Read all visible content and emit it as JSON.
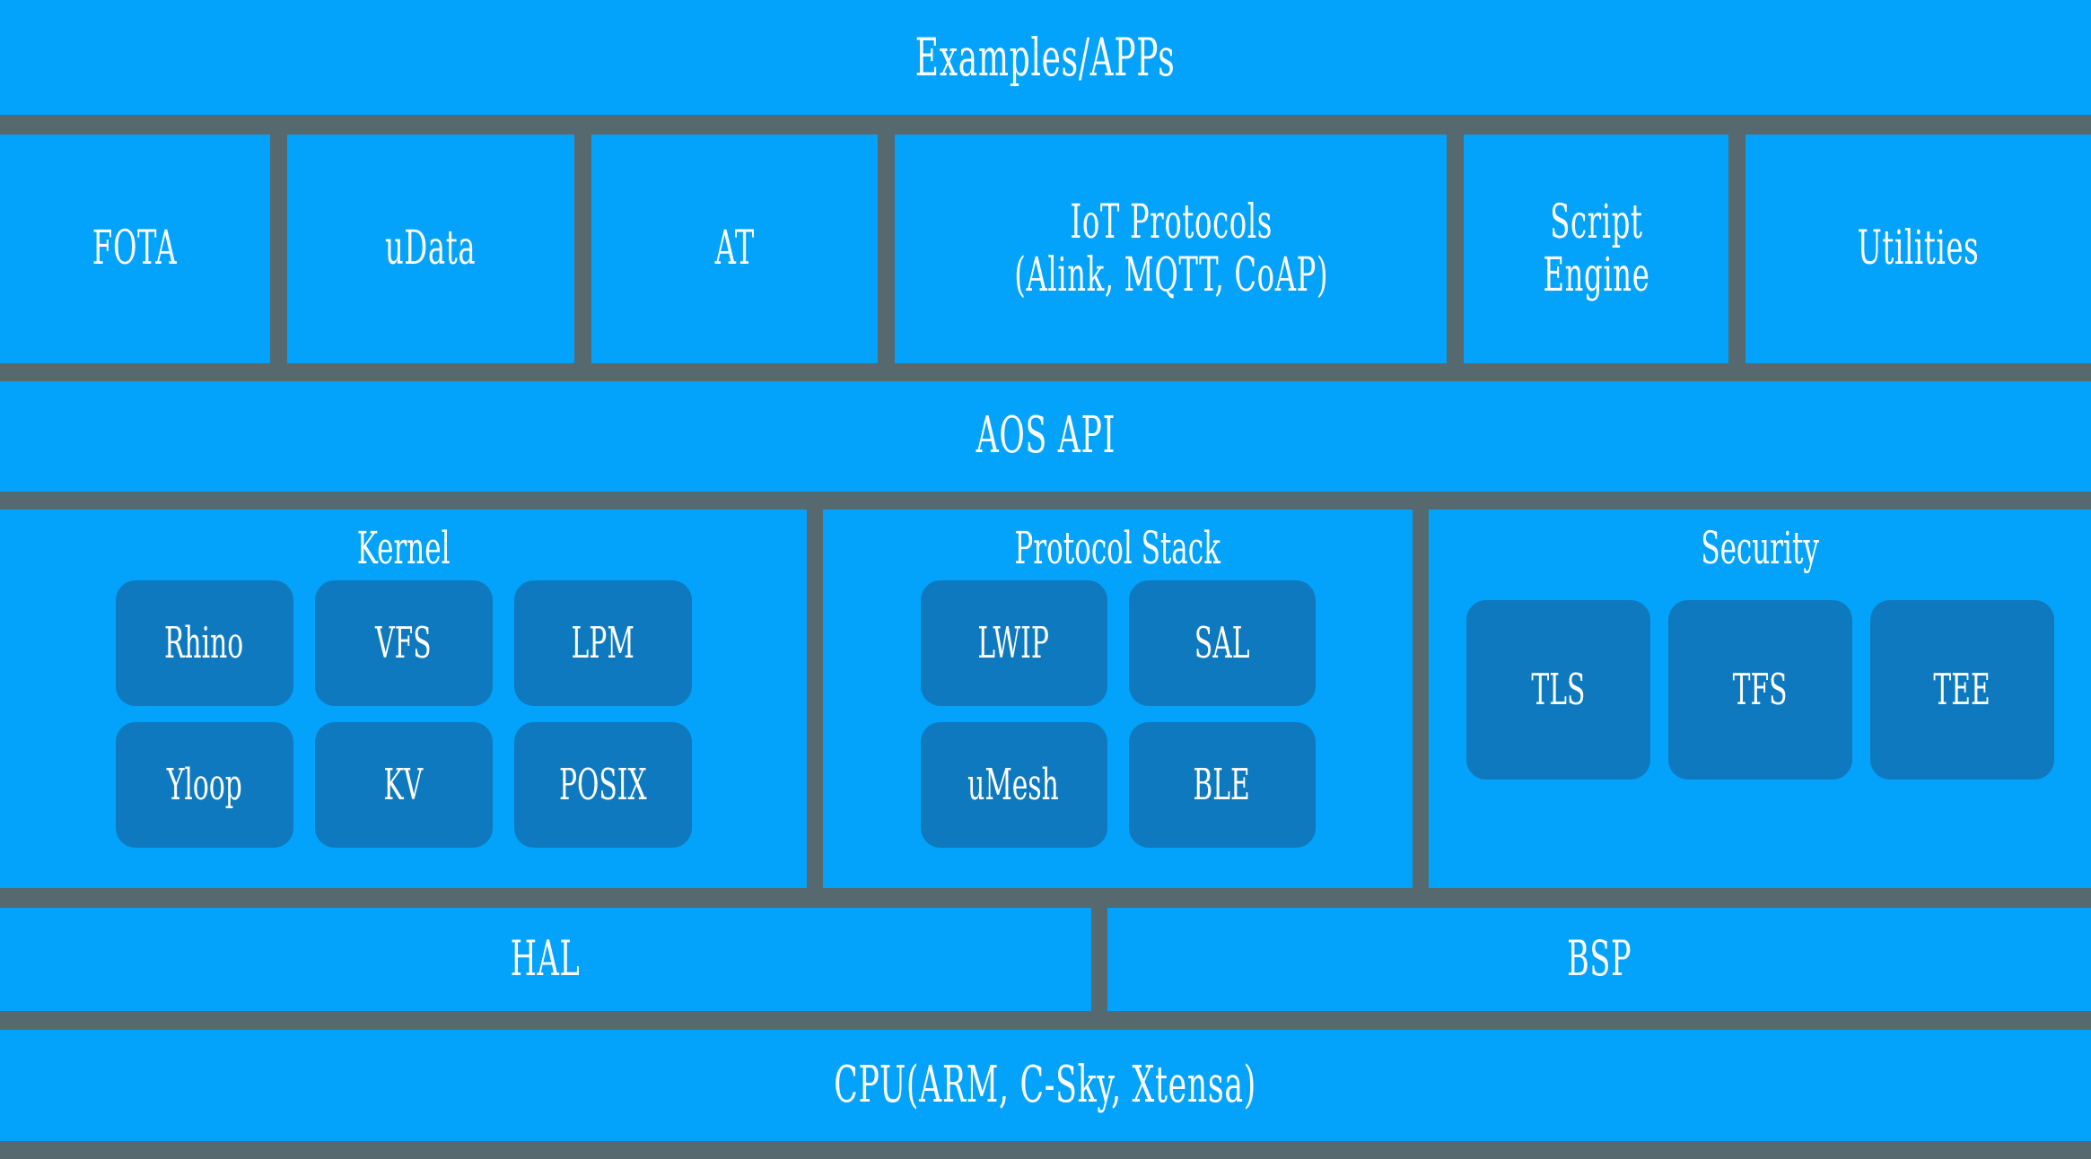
{
  "diagram": {
    "title": "AliOS Things architecture stack",
    "colors": {
      "block_blue": "#03A3FB",
      "chip_blue": "#0E79BE",
      "background_gray": "#55696F",
      "text_white": "#FFFFFF"
    }
  },
  "layers": {
    "apps": {
      "label": "Examples/APPs"
    },
    "modules": [
      {
        "label": "FOTA"
      },
      {
        "label": "uData"
      },
      {
        "label": "AT"
      },
      {
        "label": "IoT Protocols\n(Alink, MQTT, CoAP)"
      },
      {
        "label": "Script\nEngine"
      },
      {
        "label": "Utilities"
      }
    ],
    "aos_api": {
      "label": "AOS API"
    },
    "core": [
      {
        "title": "Kernel",
        "chips": [
          {
            "label": "Rhino"
          },
          {
            "label": "VFS"
          },
          {
            "label": "LPM"
          },
          {
            "label": "Yloop"
          },
          {
            "label": "KV"
          },
          {
            "label": "POSIX"
          }
        ]
      },
      {
        "title": "Protocol Stack",
        "chips": [
          {
            "label": "LWIP"
          },
          {
            "label": "SAL"
          },
          {
            "label": "uMesh"
          },
          {
            "label": "BLE"
          }
        ]
      },
      {
        "title": "Security",
        "chips": [
          {
            "label": "TLS"
          },
          {
            "label": "TFS"
          },
          {
            "label": "TEE"
          }
        ]
      }
    ],
    "platform": [
      {
        "label": "HAL"
      },
      {
        "label": "BSP"
      }
    ],
    "cpu": {
      "label": "CPU(ARM, C-Sky, Xtensa)"
    }
  }
}
